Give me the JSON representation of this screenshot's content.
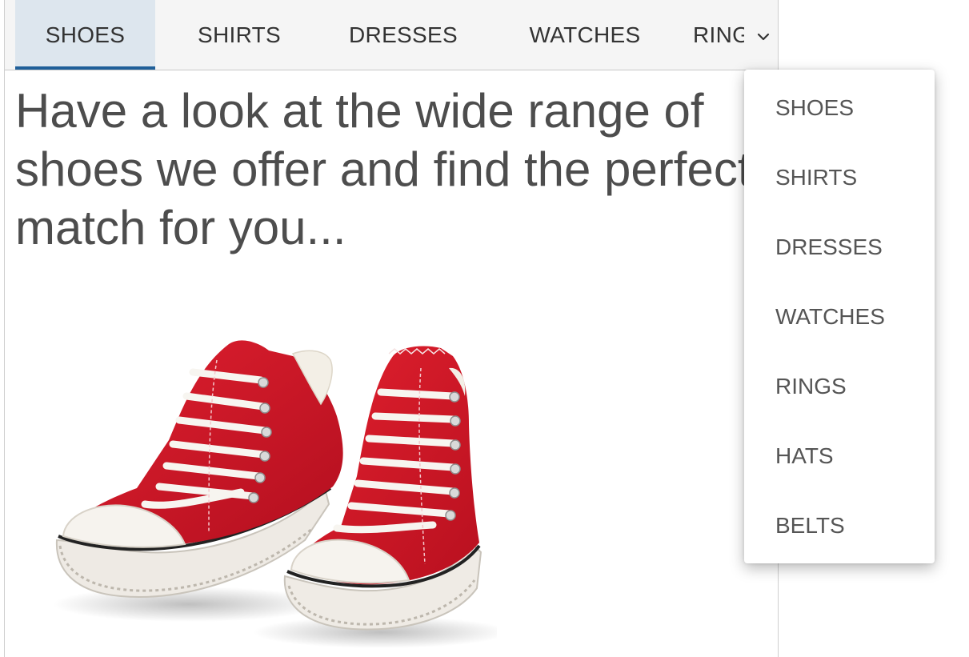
{
  "tabs": [
    {
      "label": "SHOES",
      "active": true
    },
    {
      "label": "SHIRTS",
      "active": false
    },
    {
      "label": "DRESSES",
      "active": false
    },
    {
      "label": "WATCHES",
      "active": false
    },
    {
      "label": "RINGS",
      "active": false
    }
  ],
  "overflow_icon": "chevron-down-icon",
  "content": {
    "headline": "Have a look at the wide range of shoes we offer and find the perfect match for you...",
    "image_subject": "pair of red canvas sneakers with white laces and toe caps"
  },
  "dropdown": {
    "items": [
      "SHOES",
      "SHIRTS",
      "DRESSES",
      "WATCHES",
      "RINGS",
      "HATS",
      "BELTS"
    ]
  },
  "colors": {
    "active_tab_bg": "#dde6ee",
    "active_indicator": "#1f5f99",
    "shoe_red": "#d3162a",
    "text": "#444444"
  }
}
